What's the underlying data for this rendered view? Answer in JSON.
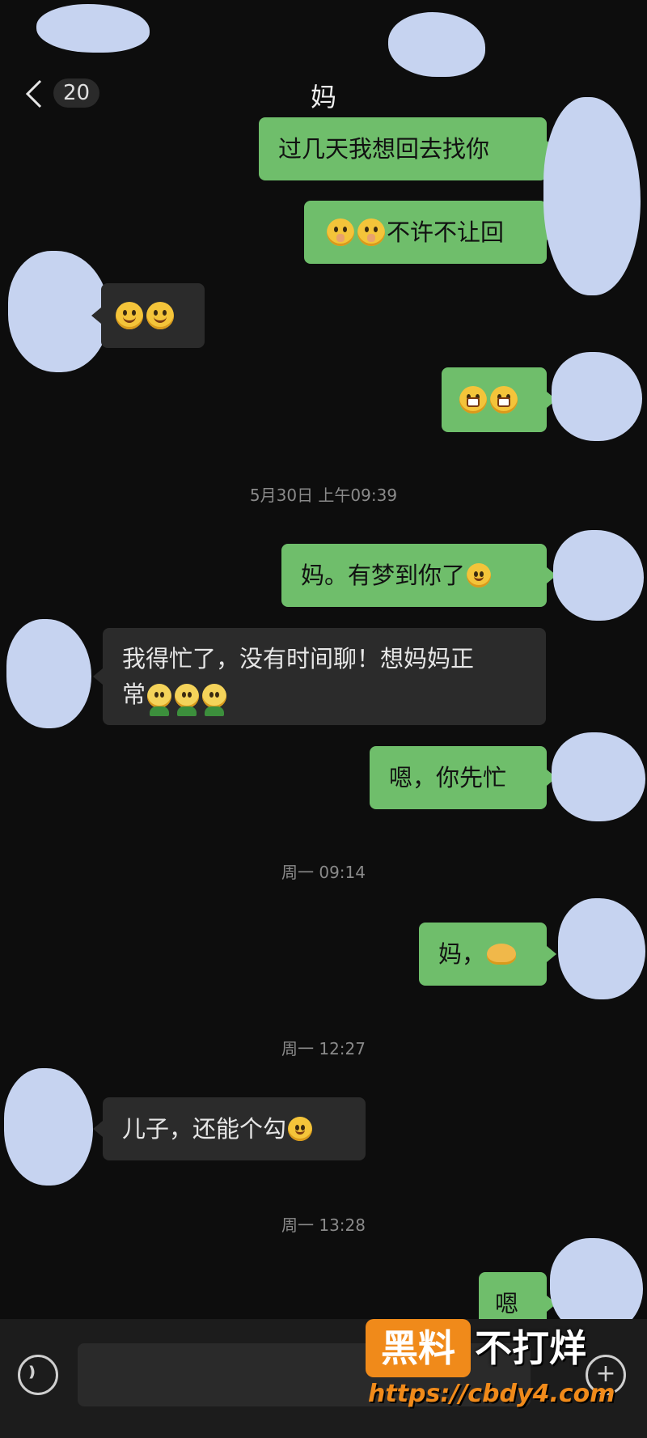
{
  "header": {
    "back_icon": "chevron-left-icon",
    "unread_count": "20",
    "title": "妈"
  },
  "messages": [
    {
      "side": "me",
      "text": "过几天我想回去找你"
    },
    {
      "side": "me",
      "text": "不许不让回",
      "emoji": [
        "shush-face",
        "shush-face"
      ]
    },
    {
      "side": "other",
      "text": "",
      "emoji": [
        "smile-face",
        "smile-face"
      ]
    },
    {
      "side": "me",
      "text": "",
      "emoji": [
        "grin-face",
        "grin-face"
      ]
    },
    {
      "side": "me",
      "text": "妈。有梦到你了",
      "emoji": [
        "thinking-face"
      ]
    },
    {
      "side": "other",
      "text_line1": "我得忙了，没有时间聊！想妈妈正",
      "text_line2": "常",
      "emoji": [
        "green-shirt-person",
        "green-shirt-person",
        "green-shirt-person"
      ]
    },
    {
      "side": "me",
      "text": "嗯，你先忙"
    },
    {
      "side": "me",
      "text": "妈，",
      "emoji": [
        "snail"
      ]
    },
    {
      "side": "other",
      "text": "儿子，还能个勾",
      "emoji": [
        "wink-tongue-face"
      ]
    },
    {
      "side": "me",
      "text": "嗯"
    }
  ],
  "timestamps": {
    "t1": "5月30日 上午09:39",
    "t2": "周一 09:14",
    "t3": "周一 12:27",
    "t4": "周一 13:28"
  },
  "input_bar": {
    "voice_icon": "voice-icon",
    "plus_icon": "plus-icon",
    "plus_label": "+"
  },
  "watermark": {
    "box_text": "黑料",
    "text": "不打烊",
    "url": "https://cbdy4.com"
  },
  "colors": {
    "background": "#0d0d0d",
    "my_bubble": "#6fbe6b",
    "other_bubble": "#2b2b2b",
    "avatar_blur": "#c6d3f0",
    "watermark_orange": "#f08a1a"
  }
}
